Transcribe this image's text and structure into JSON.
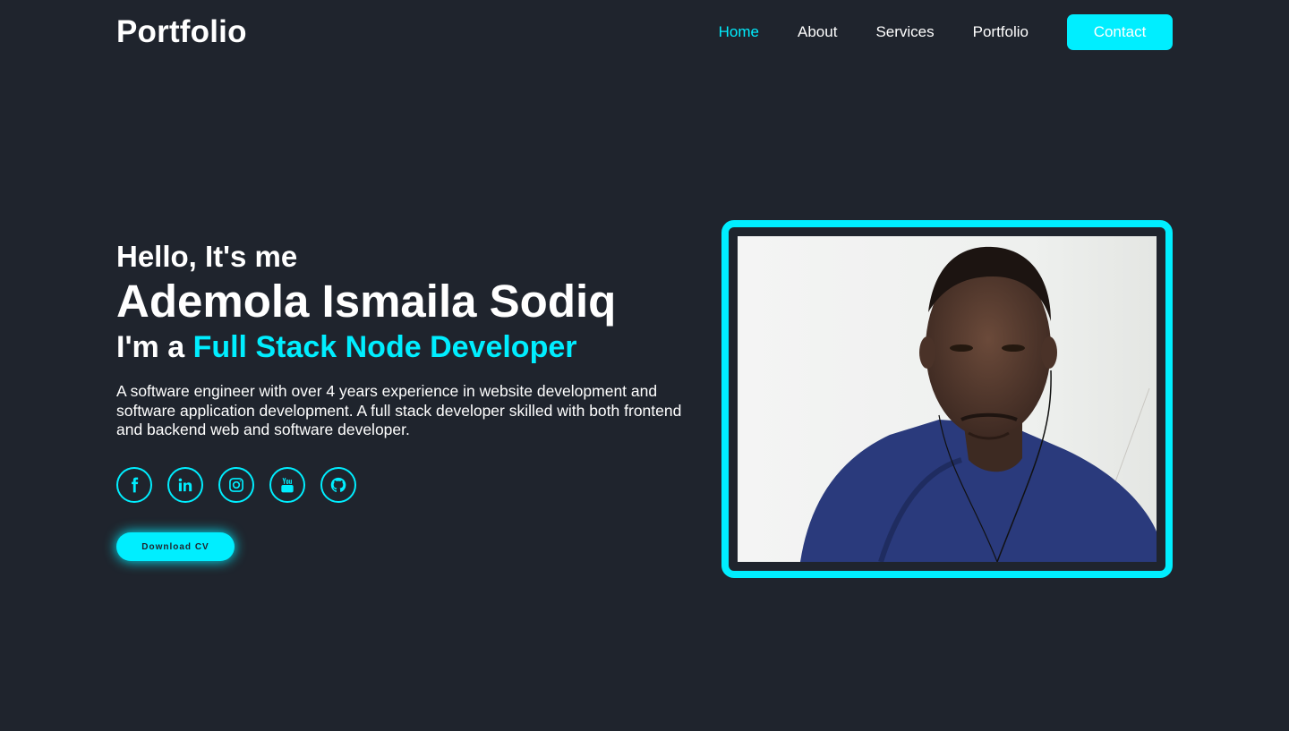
{
  "header": {
    "logo": "Portfolio",
    "nav": [
      {
        "label": "Home",
        "active": true
      },
      {
        "label": "About",
        "active": false
      },
      {
        "label": "Services",
        "active": false
      },
      {
        "label": "Portfolio",
        "active": false
      }
    ],
    "contact_label": "Contact"
  },
  "hero": {
    "greeting": "Hello, It's me",
    "name": "Ademola Ismaila Sodiq",
    "role_prefix": "I'm a",
    "role_highlight": "Full Stack Node Developer",
    "bio": "A software engineer with over 4 years experience in website development and software application development. A full stack developer skilled with both frontend and backend web and software developer.",
    "socials": [
      "facebook-icon",
      "linkedin-icon",
      "instagram-icon",
      "youtube-icon",
      "github-icon"
    ],
    "cv_label": "Download CV"
  },
  "colors": {
    "background": "#1f242d",
    "accent": "#00eeff",
    "text": "#ffffff"
  }
}
